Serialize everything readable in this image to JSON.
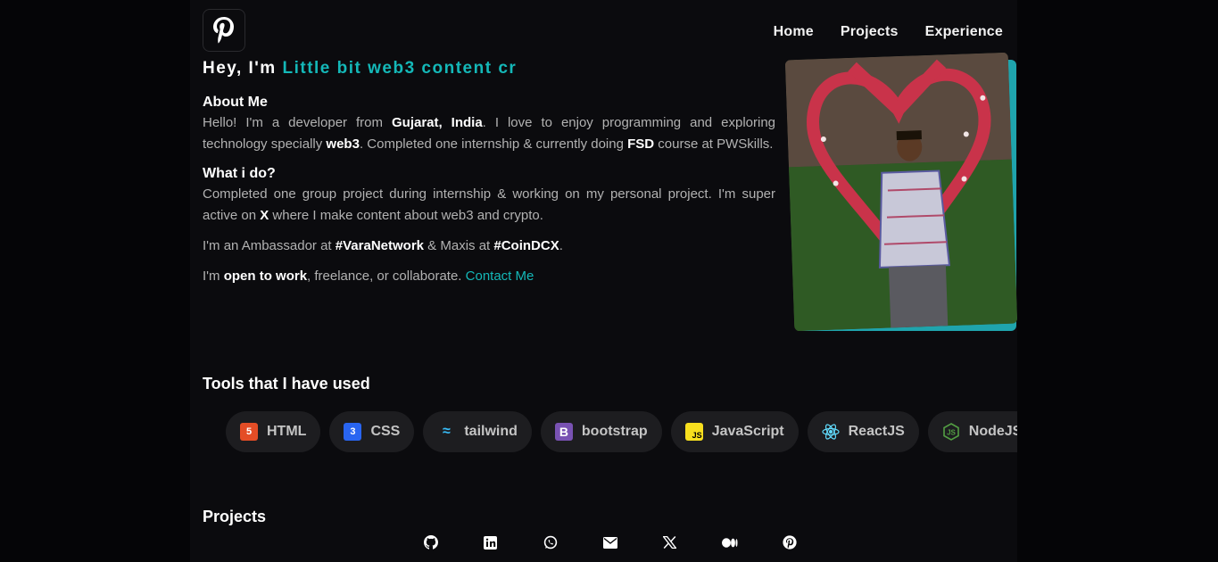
{
  "nav": {
    "items": [
      {
        "label": "Home"
      },
      {
        "label": "Projects"
      },
      {
        "label": "Experience"
      }
    ]
  },
  "hero": {
    "greeting": "Hey, I'm ",
    "typed_text": "Little bit web3 content cr"
  },
  "about": {
    "heading": "About Me",
    "p1": {
      "t1": "Hello! I'm a developer from ",
      "b1": "Gujarat, India",
      "t2": ". I love to enjoy programming and exploring technology specially ",
      "b2": "web3",
      "t3": ". Completed one internship & currently doing ",
      "b3": "FSD",
      "t4": " course at PWSkills."
    },
    "what_heading": "What i do?",
    "p2": {
      "t1": "Completed one group project during internship & working on my personal project. I'm super active on ",
      "b1": "X",
      "t2": " where I make content about web3 and crypto."
    },
    "p3": {
      "t1": "I'm an Ambassador at ",
      "b1": "#VaraNetwork",
      "t2": " & Maxis at ",
      "b2": "#CoinDCX",
      "t3": "."
    },
    "p4": {
      "t1": "I'm ",
      "b1": "open to work",
      "t2": ", freelance, or collaborate. ",
      "link": "Contact Me"
    }
  },
  "tools": {
    "title": "Tools that I have used",
    "items": [
      {
        "label": "HTML",
        "icon": "html5-icon",
        "color": "#e44d26"
      },
      {
        "label": "CSS",
        "icon": "css3-icon",
        "color": "#2965f1"
      },
      {
        "label": "tailwind",
        "icon": "tailwind-icon",
        "color": "#38bdf8"
      },
      {
        "label": "bootstrap",
        "icon": "bootstrap-icon",
        "color": "#7952b3"
      },
      {
        "label": "JavaScript",
        "icon": "javascript-icon",
        "color": "#f7df1e"
      },
      {
        "label": "ReactJS",
        "icon": "react-icon",
        "color": "#61dafb"
      },
      {
        "label": "NodeJS",
        "icon": "nodejs-icon",
        "color": "#539e43"
      }
    ]
  },
  "projects": {
    "title": "Projects"
  },
  "footer": {
    "icons": [
      "github-icon",
      "linkedin-icon",
      "whatsapp-icon",
      "email-icon",
      "x-icon",
      "medium-icon",
      "pinterest-icon"
    ]
  },
  "colors": {
    "accent": "#14b8b8",
    "background": "#0b0b0e",
    "photo_frame": "#1fa4ad"
  }
}
